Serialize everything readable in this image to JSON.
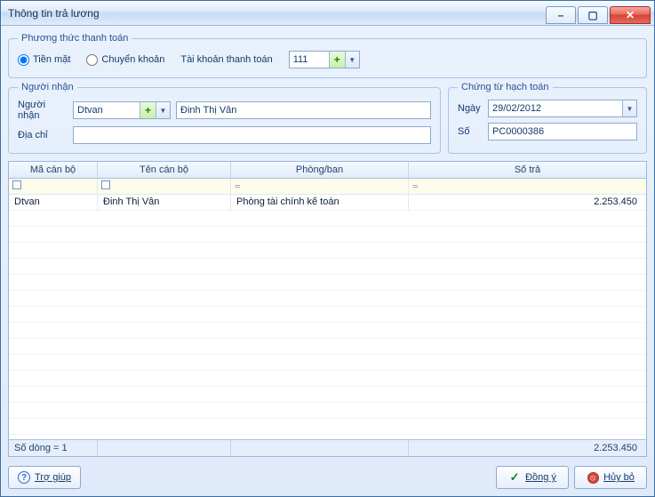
{
  "window": {
    "title": "Thông tin trả lương"
  },
  "payment_method": {
    "legend": "Phương thức thanh toán",
    "cash": "Tiền mặt",
    "transfer": "Chuyển khoản",
    "account_label": "Tài khoản thanh toán",
    "account_value": "111"
  },
  "recipient": {
    "legend": "Người nhận",
    "name_label": "Người nhận",
    "code": "Dtvan",
    "name": "Đinh Thị Vân",
    "address_label": "Địa chỉ",
    "address": ""
  },
  "voucher": {
    "legend": "Chứng từ hạch toán",
    "date_label": "Ngày",
    "date_value": "29/02/2012",
    "number_label": "Số",
    "number_value": "PC0000386"
  },
  "grid": {
    "columns": {
      "code": "Mã cán bộ",
      "name": "Tên cán bộ",
      "dept": "Phòng/ban",
      "amount": "Số trả"
    },
    "rows": [
      {
        "code": "Dtvan",
        "name": "Đinh Thị Vân",
        "dept": "Phòng tài chính kế toán",
        "amount": "2.253.450"
      }
    ],
    "footer": {
      "rowcount": "Số dòng = 1",
      "total": "2.253.450"
    }
  },
  "buttons": {
    "help": "Trợ giúp",
    "ok": "Đồng ý",
    "cancel": "Hủy bỏ"
  }
}
